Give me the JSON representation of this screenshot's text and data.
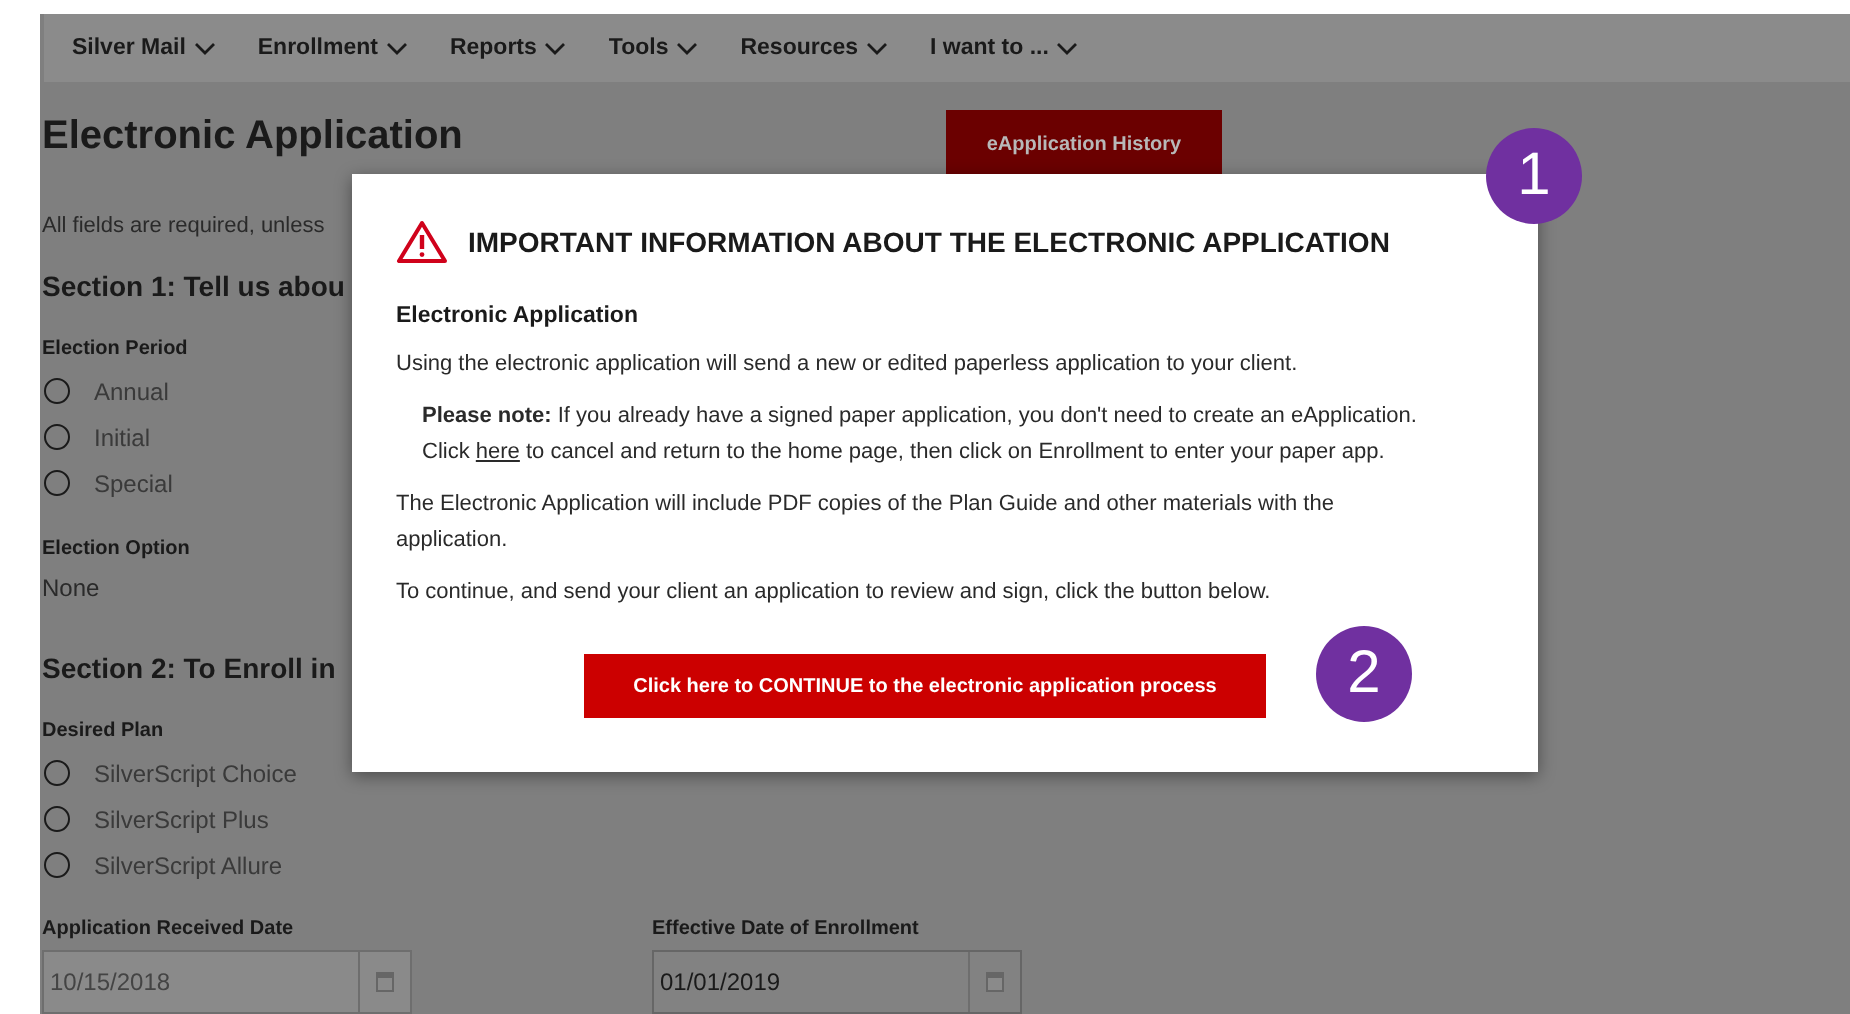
{
  "nav": [
    {
      "label": "Silver Mail"
    },
    {
      "label": "Enrollment"
    },
    {
      "label": "Reports"
    },
    {
      "label": "Tools"
    },
    {
      "label": "Resources"
    },
    {
      "label": "I want to ..."
    }
  ],
  "page_title": "Electronic Application",
  "history_button": "eApplication History",
  "intro": "All fields are required, unless",
  "sections": [
    {
      "heading": "Section 1: Tell us abou",
      "groups": [
        {
          "kind": "radio",
          "label": "Election Period",
          "options": [
            {
              "label": "Annual",
              "selected": false
            },
            {
              "label": "Initial",
              "selected": false
            },
            {
              "label": "Special",
              "selected": false
            }
          ]
        },
        {
          "kind": "text",
          "label": "Election Option",
          "value": "None"
        }
      ]
    },
    {
      "heading": "Section 2: To Enroll in",
      "groups": [
        {
          "kind": "radio",
          "label": "Desired Plan",
          "options": [
            {
              "label": "SilverScript Choice",
              "selected": false
            },
            {
              "label": "SilverScript Plus",
              "selected": false
            },
            {
              "label": "SilverScript Allure",
              "selected": false
            }
          ]
        }
      ]
    }
  ],
  "date_fields": [
    {
      "label": "Application Received Date",
      "value": "10/15/2018",
      "disabled": true
    },
    {
      "label": "Effective Date of Enrollment",
      "value": "01/01/2019",
      "disabled": false
    }
  ],
  "modal": {
    "title": "IMPORTANT INFORMATION ABOUT THE ELECTRONIC APPLICATION",
    "subtitle": "Electronic Application",
    "paragraphs": [
      {
        "kind": "plain",
        "text": "Using the electronic application will send a new or edited paperless application to your client."
      },
      {
        "kind": "note",
        "text": "**Please note:** If you already have a signed paper application, you don't need to create an eApplication.",
        "before_link": "Click",
        "link": "here",
        "after_link": "to cancel and return to the home page, then click on Enrollment to enter your paper app."
      },
      {
        "kind": "plain",
        "text": "The Electronic Application will include PDF copies of the Plan Guide and other materials with the application."
      },
      {
        "kind": "plain",
        "text": "To continue, and send your client an application to review and sign, click the button below."
      }
    ],
    "continue_button": "Click here to CONTINUE to the electronic application process"
  },
  "callouts": [
    {
      "label": "1"
    },
    {
      "label": "2"
    }
  ]
}
